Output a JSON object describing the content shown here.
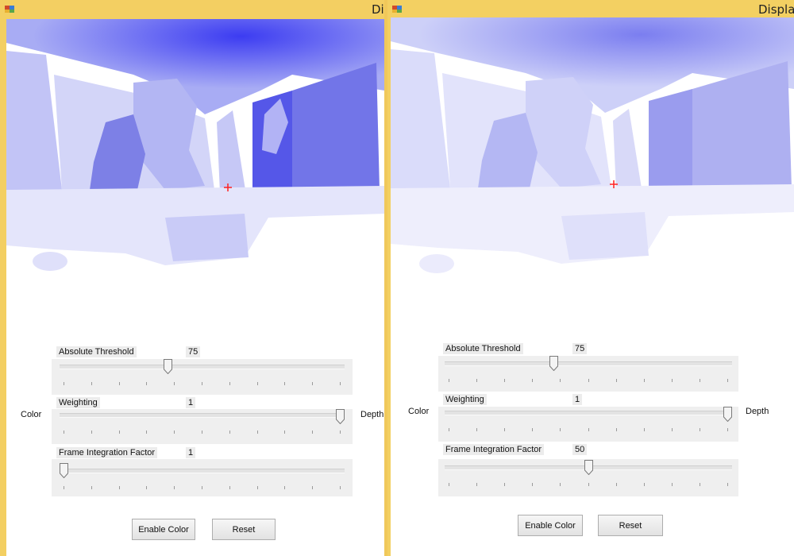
{
  "left_window": {
    "title": "Di",
    "color_label": "Color",
    "depth_label": "Depth",
    "trackbars": [
      {
        "label": "Absolute Threshold",
        "value": "75",
        "level": 0.375
      },
      {
        "label": "Weighting",
        "value": "1",
        "level": 1.0
      },
      {
        "label": "Frame Integration Factor",
        "value": "1",
        "level": 0.0
      }
    ],
    "buttons": {
      "enable_color": "Enable Color",
      "reset": "Reset"
    }
  },
  "right_window": {
    "title": "Displa",
    "color_label": "Color",
    "depth_label": "Depth",
    "trackbars": [
      {
        "label": "Absolute Threshold",
        "value": "75",
        "level": 0.375
      },
      {
        "label": "Weighting",
        "value": "1",
        "level": 1.0
      },
      {
        "label": "Frame Integration Factor",
        "value": "50",
        "level": 0.5
      }
    ],
    "buttons": {
      "enable_color": "Enable Color",
      "reset": "Reset"
    }
  },
  "colors": {
    "title_bar": "#f3cf62",
    "depth_near": "#4b4bf0",
    "depth_far": "#d8daf8",
    "marker": "#ff2020"
  }
}
